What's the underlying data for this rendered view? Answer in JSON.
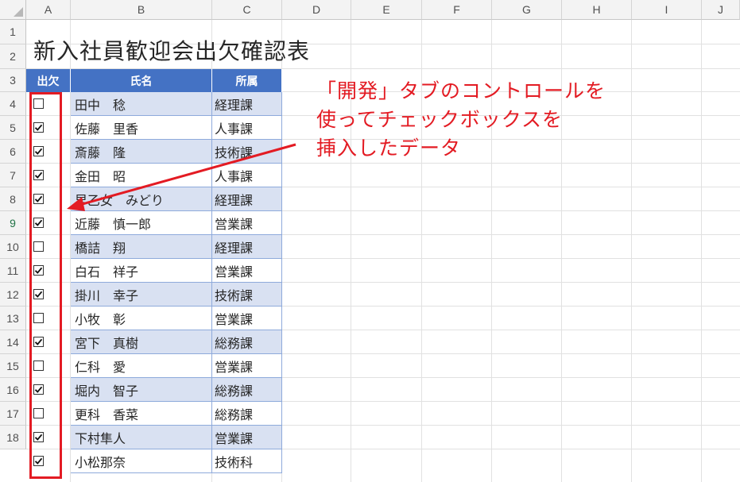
{
  "columns": [
    "A",
    "B",
    "C",
    "D",
    "E",
    "F",
    "G",
    "H",
    "I",
    "J"
  ],
  "rows": [
    "1",
    "2",
    "3",
    "4",
    "5",
    "6",
    "7",
    "8",
    "9",
    "10",
    "11",
    "12",
    "13",
    "14",
    "15",
    "16",
    "17",
    "18"
  ],
  "title": "新入社員歓迎会出欠確認表",
  "table": {
    "headers": {
      "attendance": "出欠",
      "name": "氏名",
      "dept": "所属"
    },
    "records": [
      {
        "checked": false,
        "name": "田中　稔",
        "dept": "経理課"
      },
      {
        "checked": true,
        "name": "佐藤　里香",
        "dept": "人事課"
      },
      {
        "checked": true,
        "name": "斎藤　隆",
        "dept": "技術課"
      },
      {
        "checked": true,
        "name": "金田　昭",
        "dept": "人事課"
      },
      {
        "checked": true,
        "name": "早乙女　みどり",
        "dept": "経理課"
      },
      {
        "checked": true,
        "name": "近藤　慎一郎",
        "dept": "営業課"
      },
      {
        "checked": false,
        "name": "橋詰　翔",
        "dept": "経理課"
      },
      {
        "checked": true,
        "name": "白石　祥子",
        "dept": "営業課"
      },
      {
        "checked": true,
        "name": "掛川　幸子",
        "dept": "技術課"
      },
      {
        "checked": false,
        "name": "小牧　彰",
        "dept": "営業課"
      },
      {
        "checked": true,
        "name": "宮下　真樹",
        "dept": "総務課"
      },
      {
        "checked": false,
        "name": "仁科　愛",
        "dept": "営業課"
      },
      {
        "checked": true,
        "name": "堀内　智子",
        "dept": "総務課"
      },
      {
        "checked": false,
        "name": "更科　香菜",
        "dept": "総務課"
      },
      {
        "checked": true,
        "name": "下村隼人",
        "dept": "営業課"
      },
      {
        "checked": true,
        "name": "小松那奈",
        "dept": "技術科"
      }
    ]
  },
  "annotation": {
    "lines": [
      "「開発」タブのコントロールを",
      "使ってチェックボックスを",
      "挿入したデータ"
    ]
  },
  "colors": {
    "header_fill": "#4472c4",
    "band_fill": "#d9e1f2",
    "annotation": "#e31b23"
  }
}
